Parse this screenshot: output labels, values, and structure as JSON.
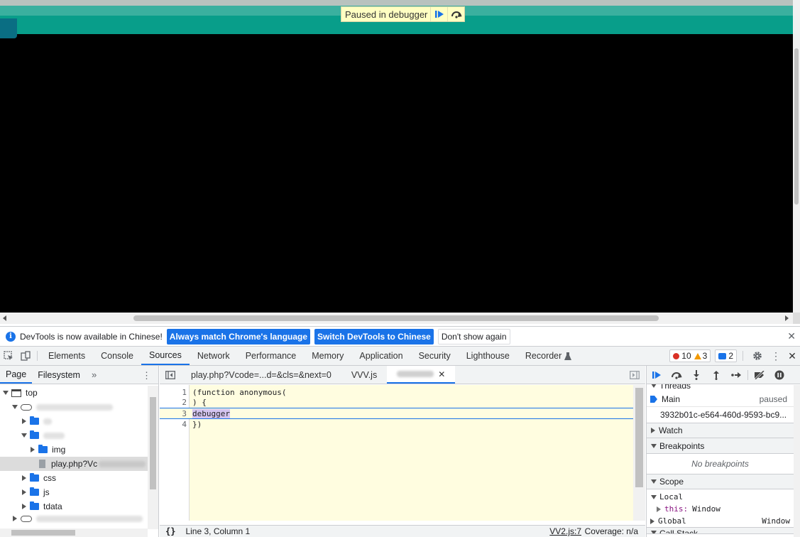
{
  "paused_banner": {
    "text": "Paused in debugger"
  },
  "infobar": {
    "message": "DevTools is now available in Chinese!",
    "btn_match": "Always match Chrome's language",
    "btn_switch": "Switch DevTools to Chinese",
    "btn_dismiss": "Don't show again"
  },
  "tabs": [
    "Elements",
    "Console",
    "Sources",
    "Network",
    "Performance",
    "Memory",
    "Application",
    "Security",
    "Lighthouse",
    "Recorder"
  ],
  "counts": {
    "errors": "10",
    "warnings": "3",
    "messages": "2"
  },
  "navigator": {
    "tabs": [
      "Page",
      "Filesystem"
    ],
    "tree": {
      "top": "top",
      "img": "img",
      "file": "play.php?Vc",
      "css": "css",
      "js": "js",
      "tdata": "tdata"
    }
  },
  "editor": {
    "tabs": [
      "play.php?Vcode=...d=&cls=&next=0",
      "VVV.js"
    ],
    "lines": [
      {
        "num": "1",
        "text": "(function anonymous("
      },
      {
        "num": "2",
        "text": ") {"
      },
      {
        "num": "3",
        "text": "debugger"
      },
      {
        "num": "4",
        "text": "})"
      }
    ],
    "status_position": "Line 3, Column 1",
    "status_file": "VV2.js:7",
    "status_coverage": "Coverage: n/a"
  },
  "sidebar": {
    "threads_title": "Threads",
    "thread_main": "Main",
    "thread_status": "paused",
    "thread_id": "3932b01c-e564-460d-9593-bc9...",
    "watch": "Watch",
    "breakpoints": "Breakpoints",
    "no_breakpoints": "No breakpoints",
    "scope": "Scope",
    "local": "Local",
    "this_key": "this:",
    "this_val": "Window",
    "global": "Global",
    "global_val": "Window",
    "call_stack": "Call Stack"
  },
  "colors": {
    "accent": "#1a73e8",
    "teal": "#089e8a",
    "paused_bg": "#ffffc2"
  }
}
